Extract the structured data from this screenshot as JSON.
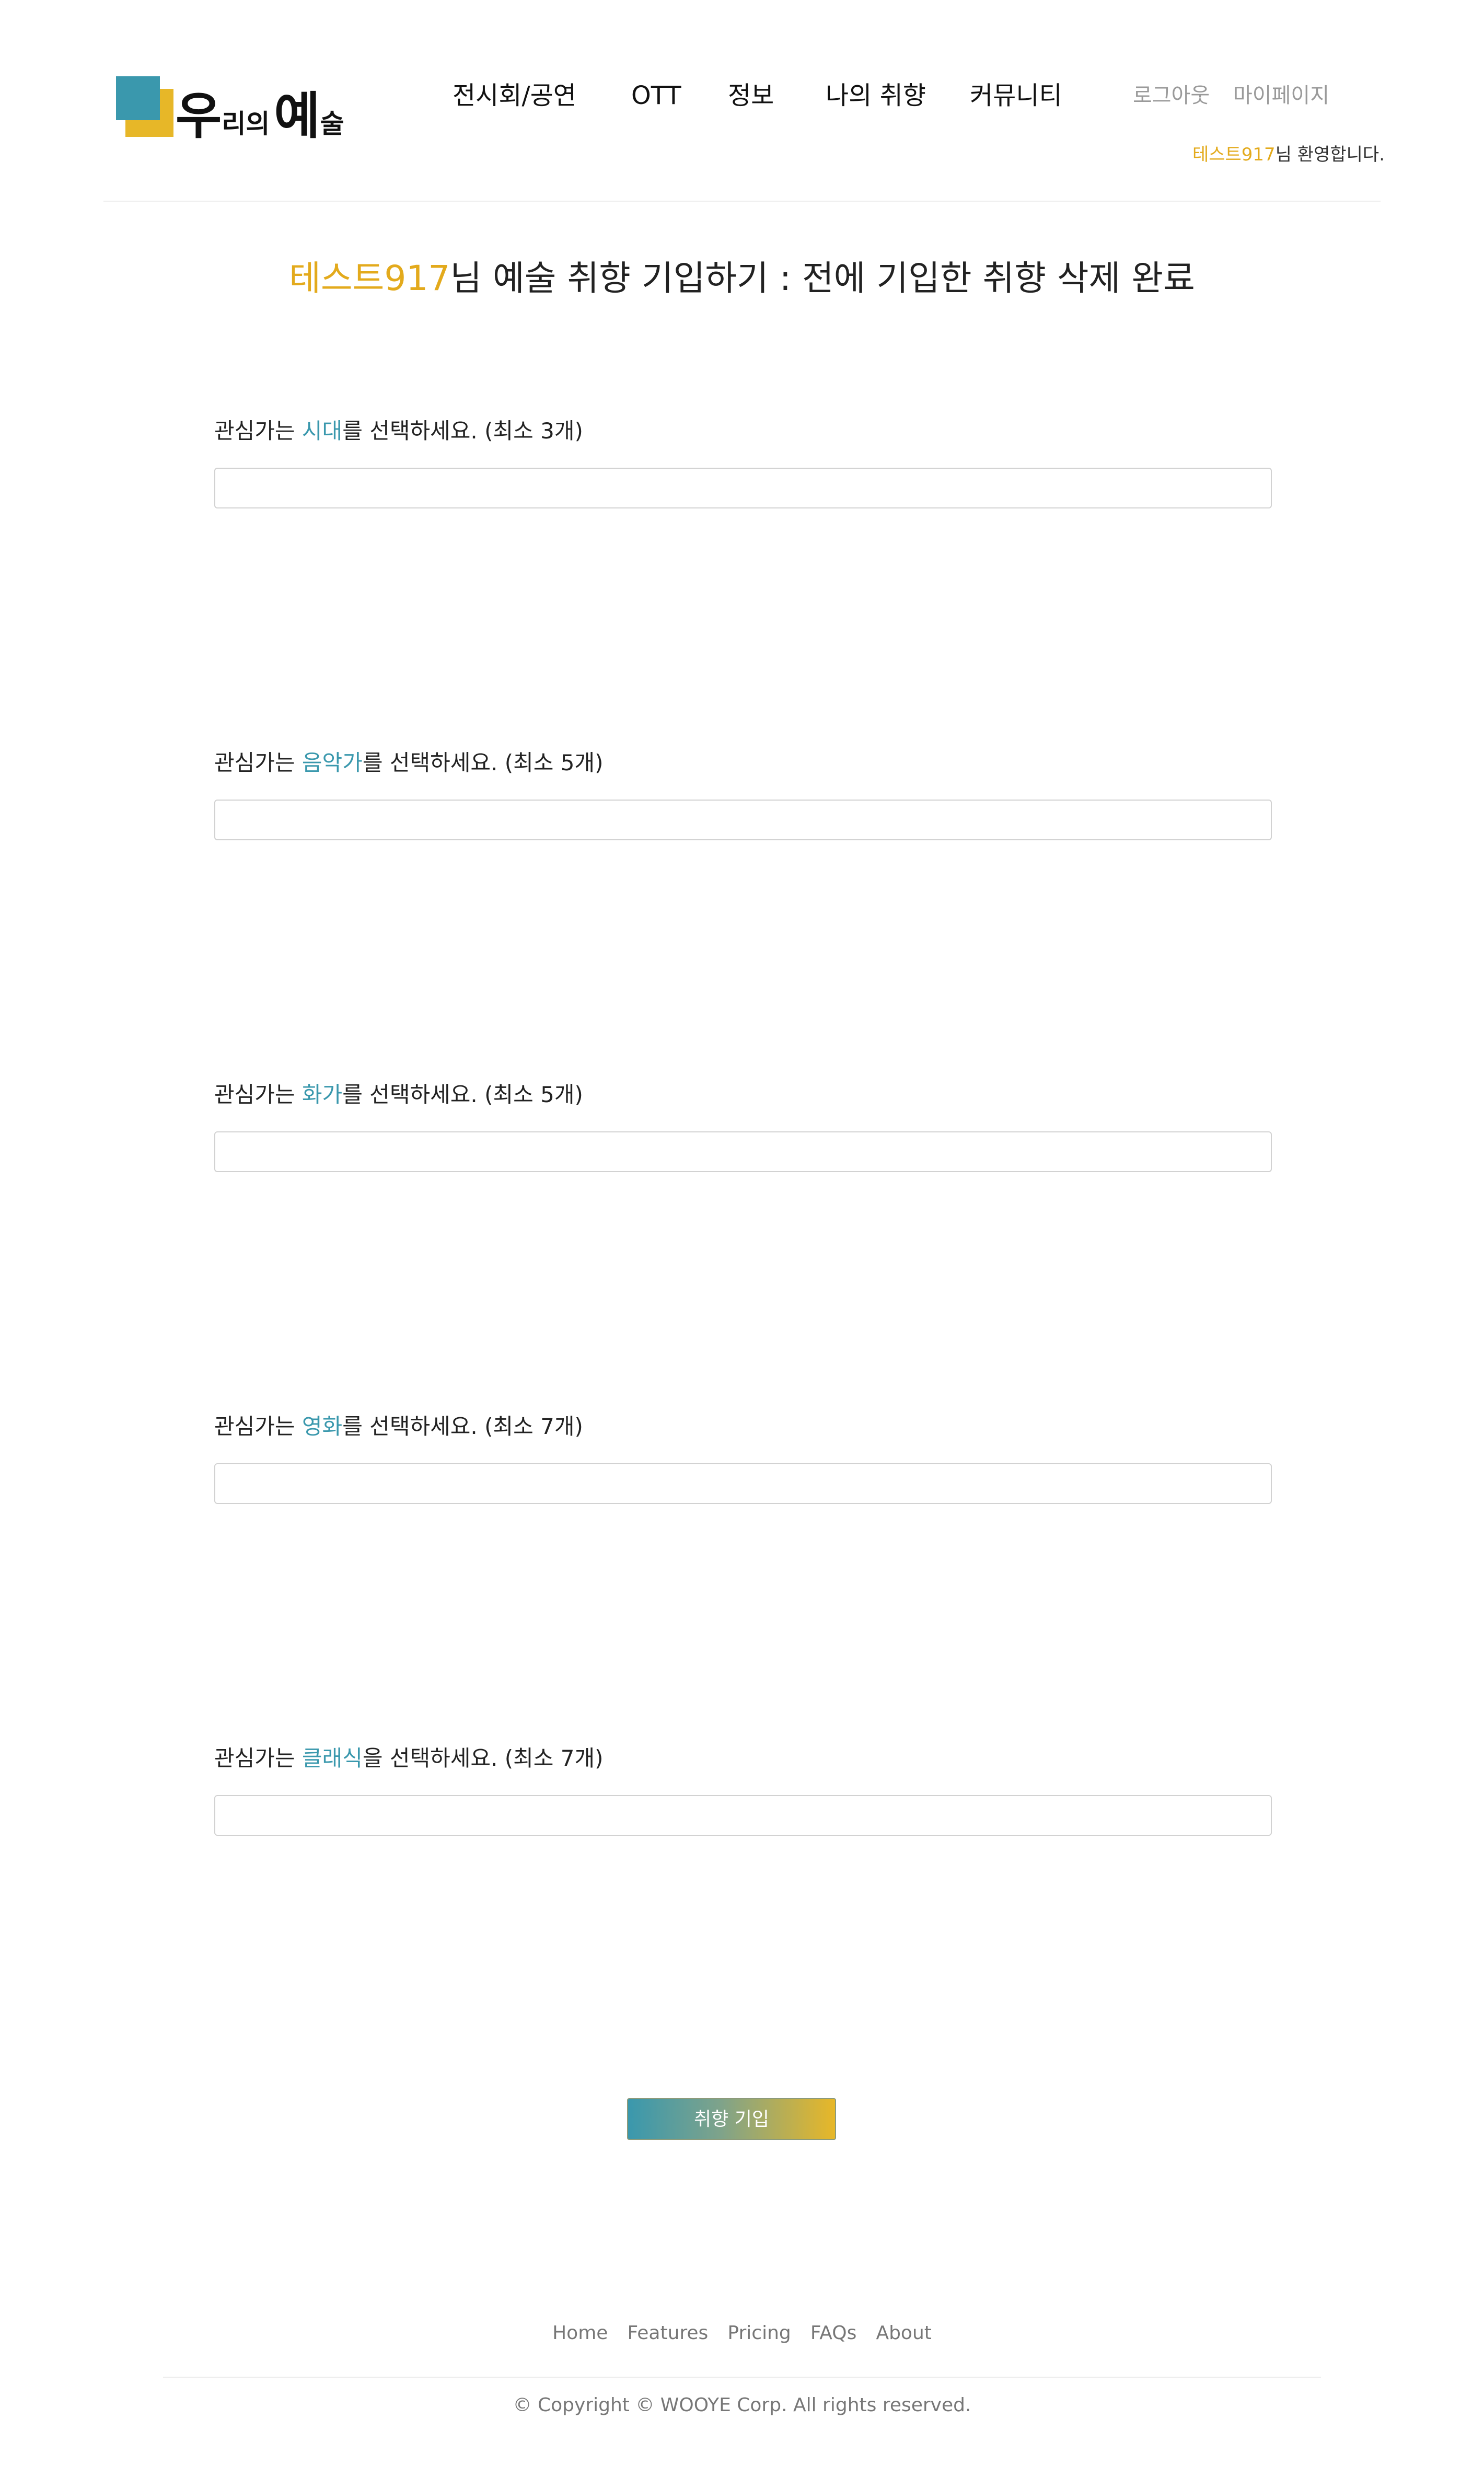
{
  "logo": {
    "part1": "우",
    "part2": "리의",
    "part3": "예",
    "part4": "술"
  },
  "nav": {
    "items": [
      "전시회/공연",
      "OTT",
      "정보",
      "나의 취향",
      "커뮤니티"
    ]
  },
  "user": {
    "logout": "로그아웃",
    "mypage": "마이페이지",
    "welcome_name": "테스트917",
    "welcome_suffix": "님 환영합니다."
  },
  "title": {
    "name": "테스트917",
    "rest": "님 예술 취향 기입하기 : 전에 기입한 취향 삭제 완료"
  },
  "sections": [
    {
      "prefix": "관심가는 ",
      "highlight": "시대",
      "suffix": "를 선택하세요. (최소 3개)",
      "value": ""
    },
    {
      "prefix": "관심가는 ",
      "highlight": "음악가",
      "suffix": "를 선택하세요. (최소 5개)",
      "value": ""
    },
    {
      "prefix": "관심가는 ",
      "highlight": "화가",
      "suffix": "를 선택하세요. (최소 5개)",
      "value": ""
    },
    {
      "prefix": "관심가는 ",
      "highlight": "영화",
      "suffix": "를 선택하세요. (최소 7개)",
      "value": ""
    },
    {
      "prefix": "관심가는 ",
      "highlight": "클래식",
      "suffix": "을 선택하세요. (최소 7개)",
      "value": ""
    }
  ],
  "submit": {
    "label": "취향 기입"
  },
  "footer": {
    "links": [
      "Home",
      "Features",
      "Pricing",
      "FAQs",
      "About"
    ],
    "copyright": "© Copyright © WOOYE Corp. All rights reserved."
  },
  "colors": {
    "accent_gold": "#e3aa1c",
    "accent_teal": "#3a98ad"
  }
}
